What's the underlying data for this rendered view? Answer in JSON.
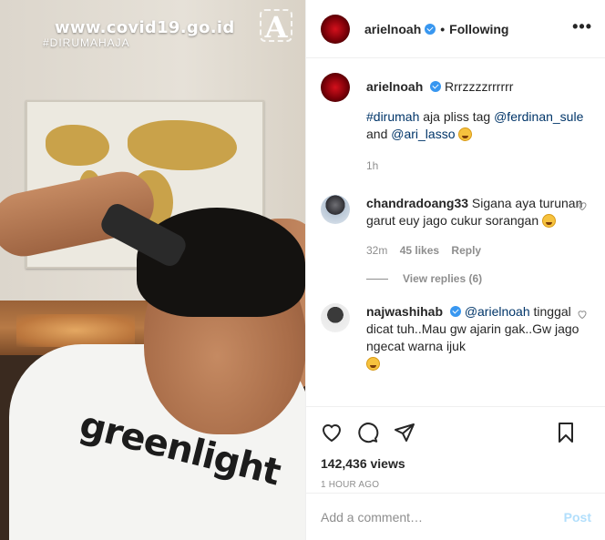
{
  "photo": {
    "overlay_url": "www.covid19.go.id",
    "overlay_hashtag": "#DIRUMAHAJA",
    "overlay_logo": "A",
    "shirt_text": "greenlight"
  },
  "header": {
    "username": "arielnoah",
    "separator": "•",
    "follow_status": "Following",
    "more_icon": "more-options-icon"
  },
  "caption": {
    "username": "arielnoah",
    "text_intro": "Rrrzzzzrrrrrr",
    "hashtag": "#dirumah",
    "text_middle": " aja pliss tag ",
    "mention1": "@ferdinan_sule",
    "text_and": " and ",
    "mention2": "@ari_lasso",
    "time": "1h"
  },
  "comments": [
    {
      "username": "chandradoang33",
      "text": "Sigana aya turunan garut euy jago cukur sorangan",
      "time": "32m",
      "likes": "45 likes",
      "reply": "Reply",
      "view_replies": "View replies (6)"
    },
    {
      "username": "najwashihab",
      "mention": "@arielnoah",
      "text": "tinggal dicat tuh..Mau gw ajarin gak..Gw jago ngecat warna ijuk"
    }
  ],
  "stats": {
    "views": "142,436 views",
    "posted": "1 HOUR AGO"
  },
  "add_comment": {
    "placeholder": "Add a comment…",
    "post_label": "Post"
  },
  "colors": {
    "verified": "#3897f0",
    "link": "#003569",
    "muted": "#8e8e8e",
    "post_disabled": "#b2dffc"
  }
}
